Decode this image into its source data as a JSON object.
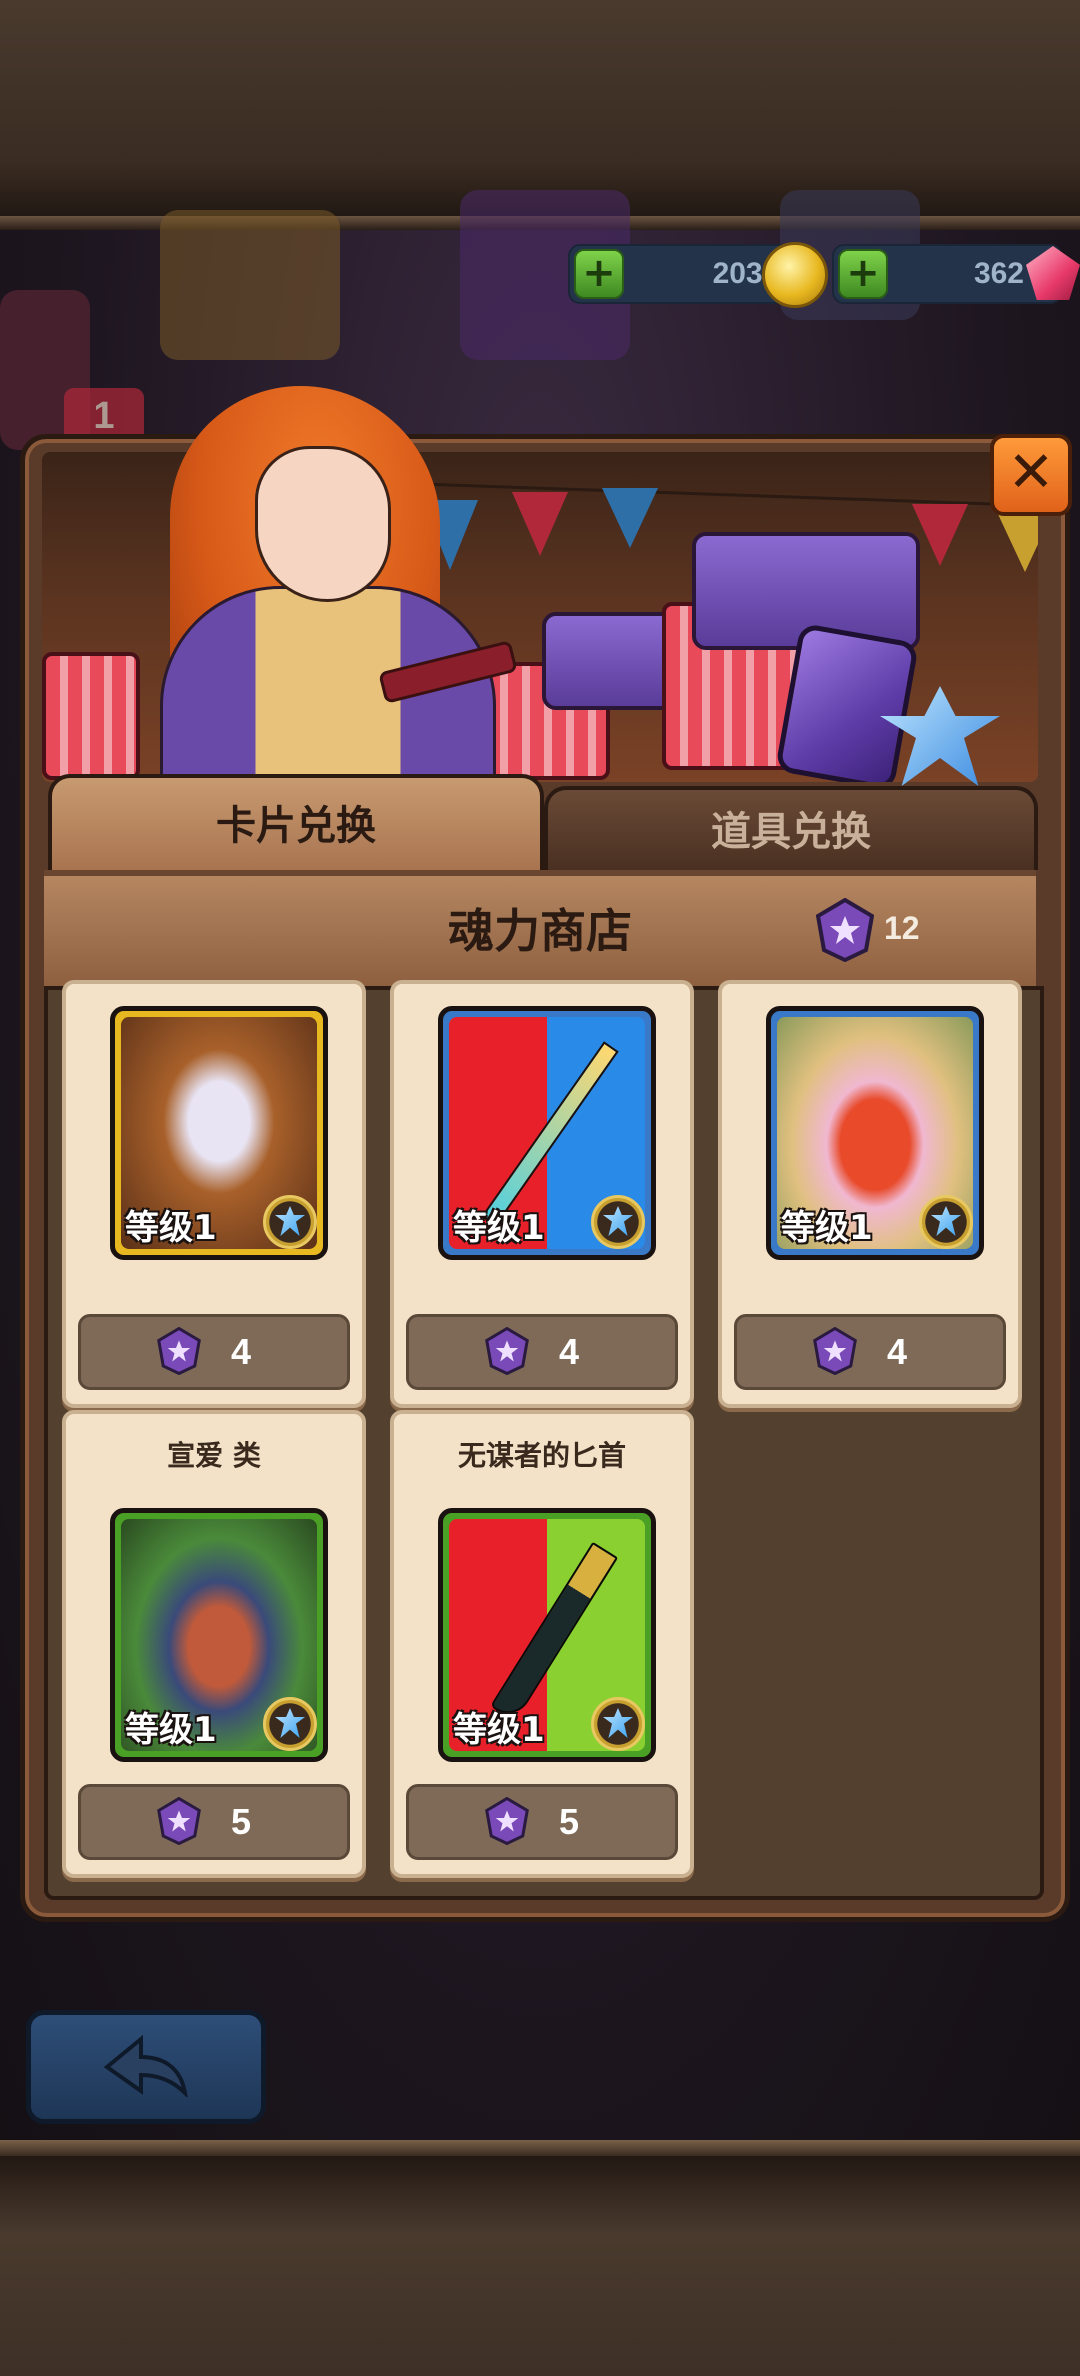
{
  "currency": {
    "gold": "20331",
    "gems": "362"
  },
  "background": {
    "badge": "1"
  },
  "tabs": [
    {
      "label": "卡片兑换",
      "active": true
    },
    {
      "label": "道具兑换",
      "active": false
    }
  ],
  "shop": {
    "title": "魂力商店",
    "soul_points": "12"
  },
  "items": [
    {
      "name": "",
      "level": "等级1",
      "price": "4",
      "frame": "gold"
    },
    {
      "name": "",
      "level": "等级1",
      "price": "4",
      "frame": "blue"
    },
    {
      "name": "",
      "level": "等级1",
      "price": "4",
      "frame": "blue"
    },
    {
      "name": "宣爱 类",
      "level": "等级1",
      "price": "5",
      "frame": "green"
    },
    {
      "name": "无谋者的匕首",
      "level": "等级1",
      "price": "5",
      "frame": "green"
    }
  ],
  "colors": {
    "gold_frame": "#e8b820",
    "blue_frame": "#3a78c8",
    "green_frame": "#4aa024",
    "accent_orange": "#ff9a3a",
    "soul_purple": "#7a4ab8"
  },
  "icons": {
    "add": "plus-icon",
    "coin": "coin-icon",
    "gem": "gem-icon",
    "close": "close-icon",
    "soul": "soul-crystal-icon",
    "star": "star-badge-icon",
    "back": "back-arrow-icon"
  }
}
